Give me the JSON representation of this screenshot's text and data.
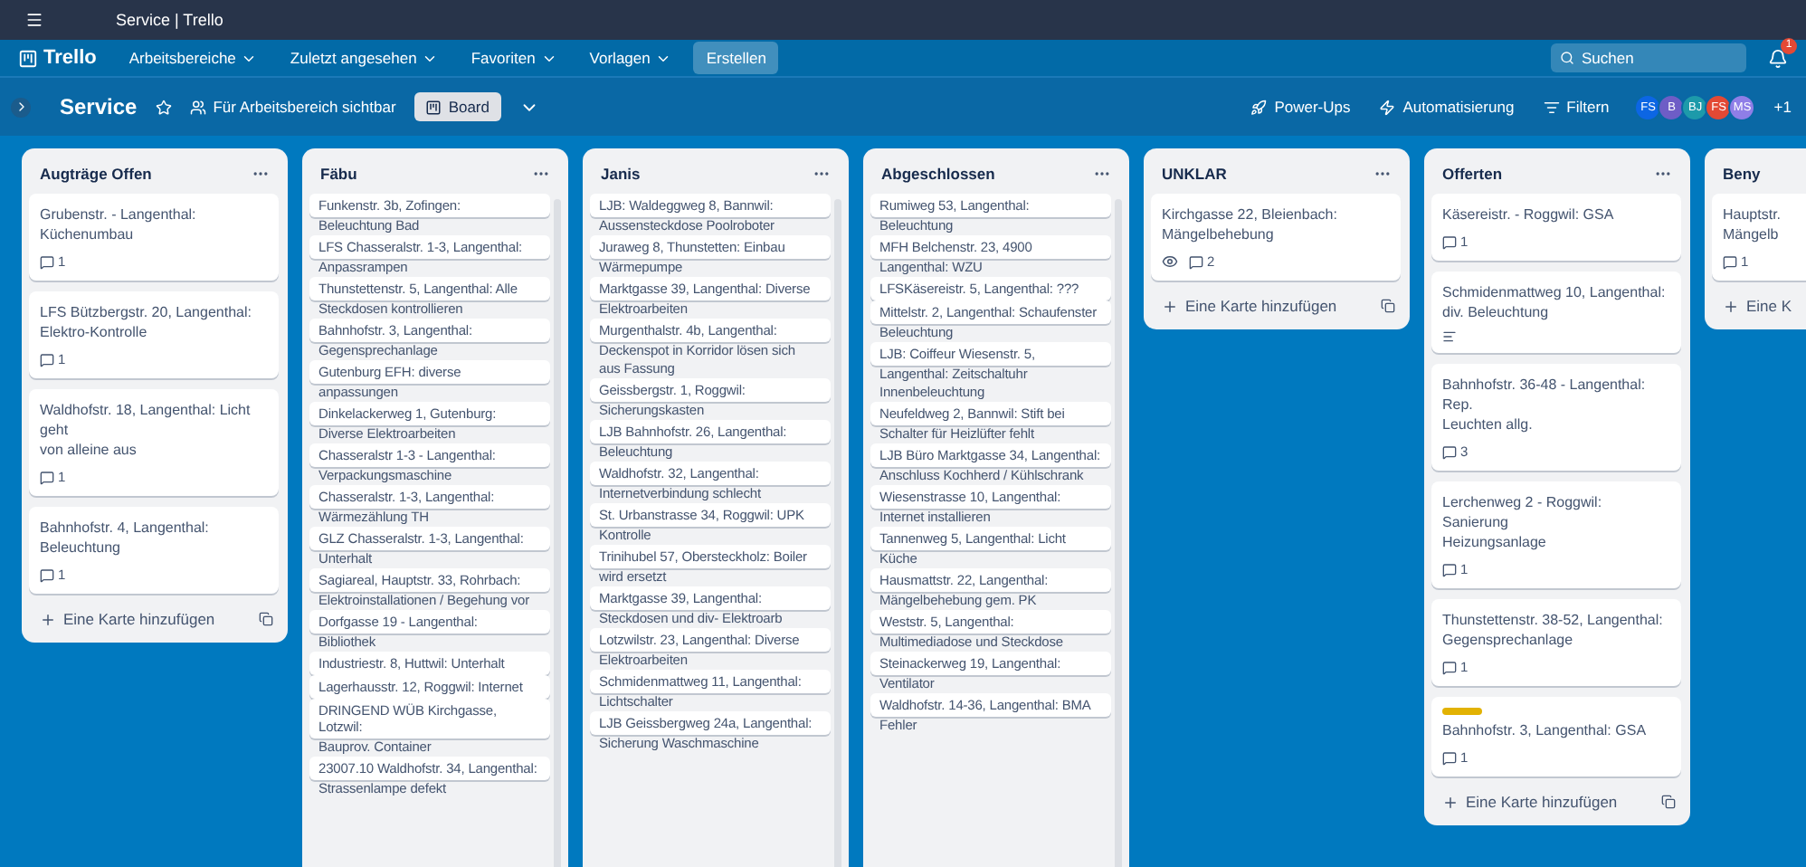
{
  "window": {
    "title": "Service | Trello"
  },
  "nav": {
    "logo": "Trello",
    "menus": [
      {
        "label": "Arbeitsbereiche"
      },
      {
        "label": "Zuletzt angesehen"
      },
      {
        "label": "Favoriten"
      },
      {
        "label": "Vorlagen"
      }
    ],
    "create": "Erstellen",
    "search": {
      "placeholder": "Suchen"
    },
    "notifications": "1"
  },
  "board": {
    "title": "Service",
    "visibility": "Für Arbeitsbereich sichtbar",
    "view": "Board",
    "actions": [
      {
        "kind": "powerups",
        "label": "Power-Ups"
      },
      {
        "kind": "automation",
        "label": "Automatisierung"
      },
      {
        "kind": "filter",
        "label": "Filtern"
      }
    ],
    "members": [
      {
        "initials": "FS",
        "color": "#0c66e4"
      },
      {
        "initials": "B",
        "color": "#6e5dc6"
      },
      {
        "initials": "BJ",
        "color": "#1d9aaa"
      },
      {
        "initials": "FS",
        "color": "#e34935"
      },
      {
        "initials": "MS",
        "color": "#8f7ee7"
      }
    ],
    "more_members": "+1"
  },
  "lists": [
    {
      "title": "Augträge Offen",
      "menu": true,
      "template": true,
      "kind": "stacked",
      "add": "Eine Karte hinzufügen",
      "cards": [
        {
          "lines": [
            "Grubenstr. - Langenthal:",
            "Küchenumbau"
          ],
          "badges": [
            {
              "kind": "comments",
              "text": "1"
            }
          ]
        },
        {
          "lines": [
            "LFS Bützbergstr. 20, Langenthal:",
            "Elektro-Kontrolle"
          ],
          "badges": [
            {
              "kind": "comments",
              "text": "1"
            }
          ]
        },
        {
          "lines": [
            "Waldhofstr. 18, Langenthal: Licht geht",
            "von alleine aus"
          ],
          "badges": [
            {
              "kind": "comments",
              "text": "1"
            }
          ]
        },
        {
          "lines": [
            "Bahnhofstr. 4, Langenthal:",
            "Beleuchtung"
          ],
          "badges": [
            {
              "kind": "comments",
              "text": "1"
            }
          ]
        }
      ]
    },
    {
      "title": "Fäbu",
      "menu": true,
      "kind": "overlap",
      "cards": [
        {
          "lines": [
            "Funkenstr. 3b, Zofingen:",
            "Beleuchtung Bad"
          ]
        },
        {
          "lines": [
            "LFS Chasseralstr. 1-3, Langenthal:",
            "Anpassrampen"
          ]
        },
        {
          "lines": [
            "Thunstettenstr. 5, Langenthal: Alle",
            "Steckdosen kontrollieren"
          ]
        },
        {
          "lines": [
            "Bahnhofstr. 3, Langenthal:",
            "Gegensprechanlage"
          ]
        },
        {
          "lines": [
            "Gutenburg EFH: diverse",
            "anpassungen"
          ]
        },
        {
          "lines": [
            "Dinkelackerweg 1, Gutenburg:",
            "Diverse Elektroarbeiten"
          ]
        },
        {
          "lines": [
            "Chasseralstr 1-3 - Langenthal:",
            "Verpackungsmaschine"
          ]
        },
        {
          "lines": [
            "Chasseralstr. 1-3, Langenthal:",
            "Wärmezählung TH"
          ]
        },
        {
          "lines": [
            "GLZ Chasseralstr. 1-3, Langenthal:",
            "Unterhalt"
          ]
        },
        {
          "lines": [
            "Sagiareal, Hauptstr. 33, Rohrbach:",
            "Elektroinstallationen / Begehung vor"
          ]
        },
        {
          "lines": [
            "Dorfgasse 19 - Langenthal:",
            "Bibliothek"
          ]
        },
        {
          "lines": [
            "Industriestr. 8, Huttwil: Unterhalt"
          ]
        },
        {
          "lines": [
            "Lagerhausstr. 12, Roggwil: Internet"
          ]
        },
        {
          "lines": [
            "DRINGEND WÜB Kirchgasse, Lotzwil:",
            "Bauprov. Container"
          ]
        },
        {
          "lines": [
            "23007.10 Waldhofstr. 34, Langenthal:",
            "Strassenlampe defekt"
          ]
        }
      ]
    },
    {
      "title": "Janis",
      "menu": true,
      "kind": "overlap",
      "cards": [
        {
          "lines": [
            "LJB: Waldeggweg 8, Bannwil:",
            "Aussensteckdose Poolroboter"
          ]
        },
        {
          "lines": [
            "Juraweg 8, Thunstetten: Einbau",
            "Wärmepumpe"
          ]
        },
        {
          "lines": [
            "Marktgasse 39, Langenthal: Diverse",
            "Elektroarbeiten"
          ]
        },
        {
          "lines": [
            "Murgenthalstr. 4b, Langenthal:",
            "Deckenspot in Korridor lösen sich",
            "aus Fassung"
          ]
        },
        {
          "lines": [
            "Geissbergstr. 1, Roggwil:",
            "Sicherungskasten"
          ]
        },
        {
          "lines": [
            "LJB Bahnhofstr. 26, Langenthal:",
            "Beleuchtung"
          ]
        },
        {
          "lines": [
            "Waldhofstr. 32, Langenthal:",
            "Internetverbindung schlecht"
          ]
        },
        {
          "lines": [
            "St. Urbanstrasse 34, Roggwil: UPK",
            "Kontrolle"
          ]
        },
        {
          "lines": [
            "Trinihubel 57, Obersteckholz: Boiler",
            "wird ersetzt"
          ]
        },
        {
          "lines": [
            "Marktgasse 39, Langenthal:",
            "Steckdosen und div- Elektroarb"
          ]
        },
        {
          "lines": [
            "Lotzwilstr. 23, Langenthal: Diverse",
            "Elektroarbeiten"
          ]
        },
        {
          "lines": [
            "Schmidenmattweg 11, Langenthal:",
            "Lichtschalter"
          ]
        },
        {
          "lines": [
            "LJB Geissbergweg 24a, Langenthal:",
            "Sicherung Waschmaschine"
          ]
        }
      ]
    },
    {
      "title": "Abgeschlossen",
      "menu": true,
      "kind": "overlap",
      "cards": [
        {
          "lines": [
            "Rumiweg 53, Langenthal:",
            "Beleuchtung"
          ]
        },
        {
          "lines": [
            "MFH Belchenstr. 23, 4900",
            "Langenthal: WZU"
          ]
        },
        {
          "lines": [
            "LFSKäsereistr. 5, Langenthal: ???"
          ]
        },
        {
          "lines": [
            "Mittelstr. 2, Langenthal: Schaufenster",
            "Beleuchtung"
          ]
        },
        {
          "lines": [
            "LJB: Coiffeur Wiesenstr. 5,",
            "Langenthal: Zeitschaltuhr",
            "Innenbeleuchtung"
          ]
        },
        {
          "lines": [
            "Neufeldweg 2, Bannwil: Stift bei",
            "Schalter für Heizlüfter fehlt"
          ]
        },
        {
          "lines": [
            "LJB Büro Marktgasse 34, Langenthal:",
            "Anschluss Kochherd / Kühlschrank"
          ]
        },
        {
          "lines": [
            "Wiesenstrasse 10, Langenthal:",
            "Internet installieren"
          ]
        },
        {
          "lines": [
            "Tannenweg 5, Langenthal: Licht",
            "Küche"
          ]
        },
        {
          "lines": [
            "Hausmattstr. 22, Langenthal:",
            "Mängelbehebung gem. PK"
          ]
        },
        {
          "lines": [
            "Weststr. 5, Langenthal:",
            "Multimediadose und Steckdose"
          ]
        },
        {
          "lines": [
            "Steinackerweg 19, Langenthal:",
            "Ventilator"
          ]
        },
        {
          "lines": [
            "Waldhofstr. 14-36, Langenthal: BMA",
            "Fehler"
          ]
        }
      ]
    },
    {
      "title": "UNKLAR",
      "menu": true,
      "template": true,
      "kind": "stacked",
      "add": "Eine Karte hinzufügen",
      "cards": [
        {
          "lines": [
            "Kirchgasse 22, Bleienbach:",
            "Mängelbehebung"
          ],
          "badges": [
            {
              "kind": "watch"
            },
            {
              "kind": "comments",
              "text": "2"
            }
          ]
        }
      ]
    },
    {
      "title": "Offerten",
      "menu": true,
      "template": true,
      "kind": "stacked",
      "add": "Eine Karte hinzufügen",
      "cards": [
        {
          "lines": [
            "Käsereistr. - Roggwil: GSA"
          ],
          "badges": [
            {
              "kind": "comments",
              "text": "1"
            }
          ]
        },
        {
          "lines": [
            "Schmidenmattweg 10, Langenthal:",
            "div. Beleuchtung"
          ],
          "badges": [
            {
              "kind": "description"
            }
          ]
        },
        {
          "lines": [
            "Bahnhofstr. 36-48 - Langenthal: Rep.",
            "Leuchten allg."
          ],
          "badges": [
            {
              "kind": "comments",
              "text": "3"
            }
          ]
        },
        {
          "lines": [
            "Lerchenweg 2 - Roggwil: Sanierung",
            "Heizungsanlage"
          ],
          "badges": [
            {
              "kind": "comments",
              "text": "1"
            }
          ]
        },
        {
          "lines": [
            "Thunstettenstr. 38-52, Langenthal:",
            "Gegensprechanlage"
          ],
          "badges": [
            {
              "kind": "comments",
              "text": "1"
            }
          ]
        },
        {
          "label": {
            "color": "#e2b203"
          },
          "lines": [
            "Bahnhofstr. 3, Langenthal: GSA"
          ],
          "badges": [
            {
              "kind": "comments",
              "text": "1"
            }
          ]
        }
      ]
    },
    {
      "title": "Beny",
      "kind": "stacked",
      "add": "Eine K",
      "cards": [
        {
          "lines": [
            "Hauptstr.",
            "Mängelb"
          ],
          "badges": [
            {
              "kind": "comments",
              "text": "1"
            }
          ]
        }
      ]
    }
  ]
}
